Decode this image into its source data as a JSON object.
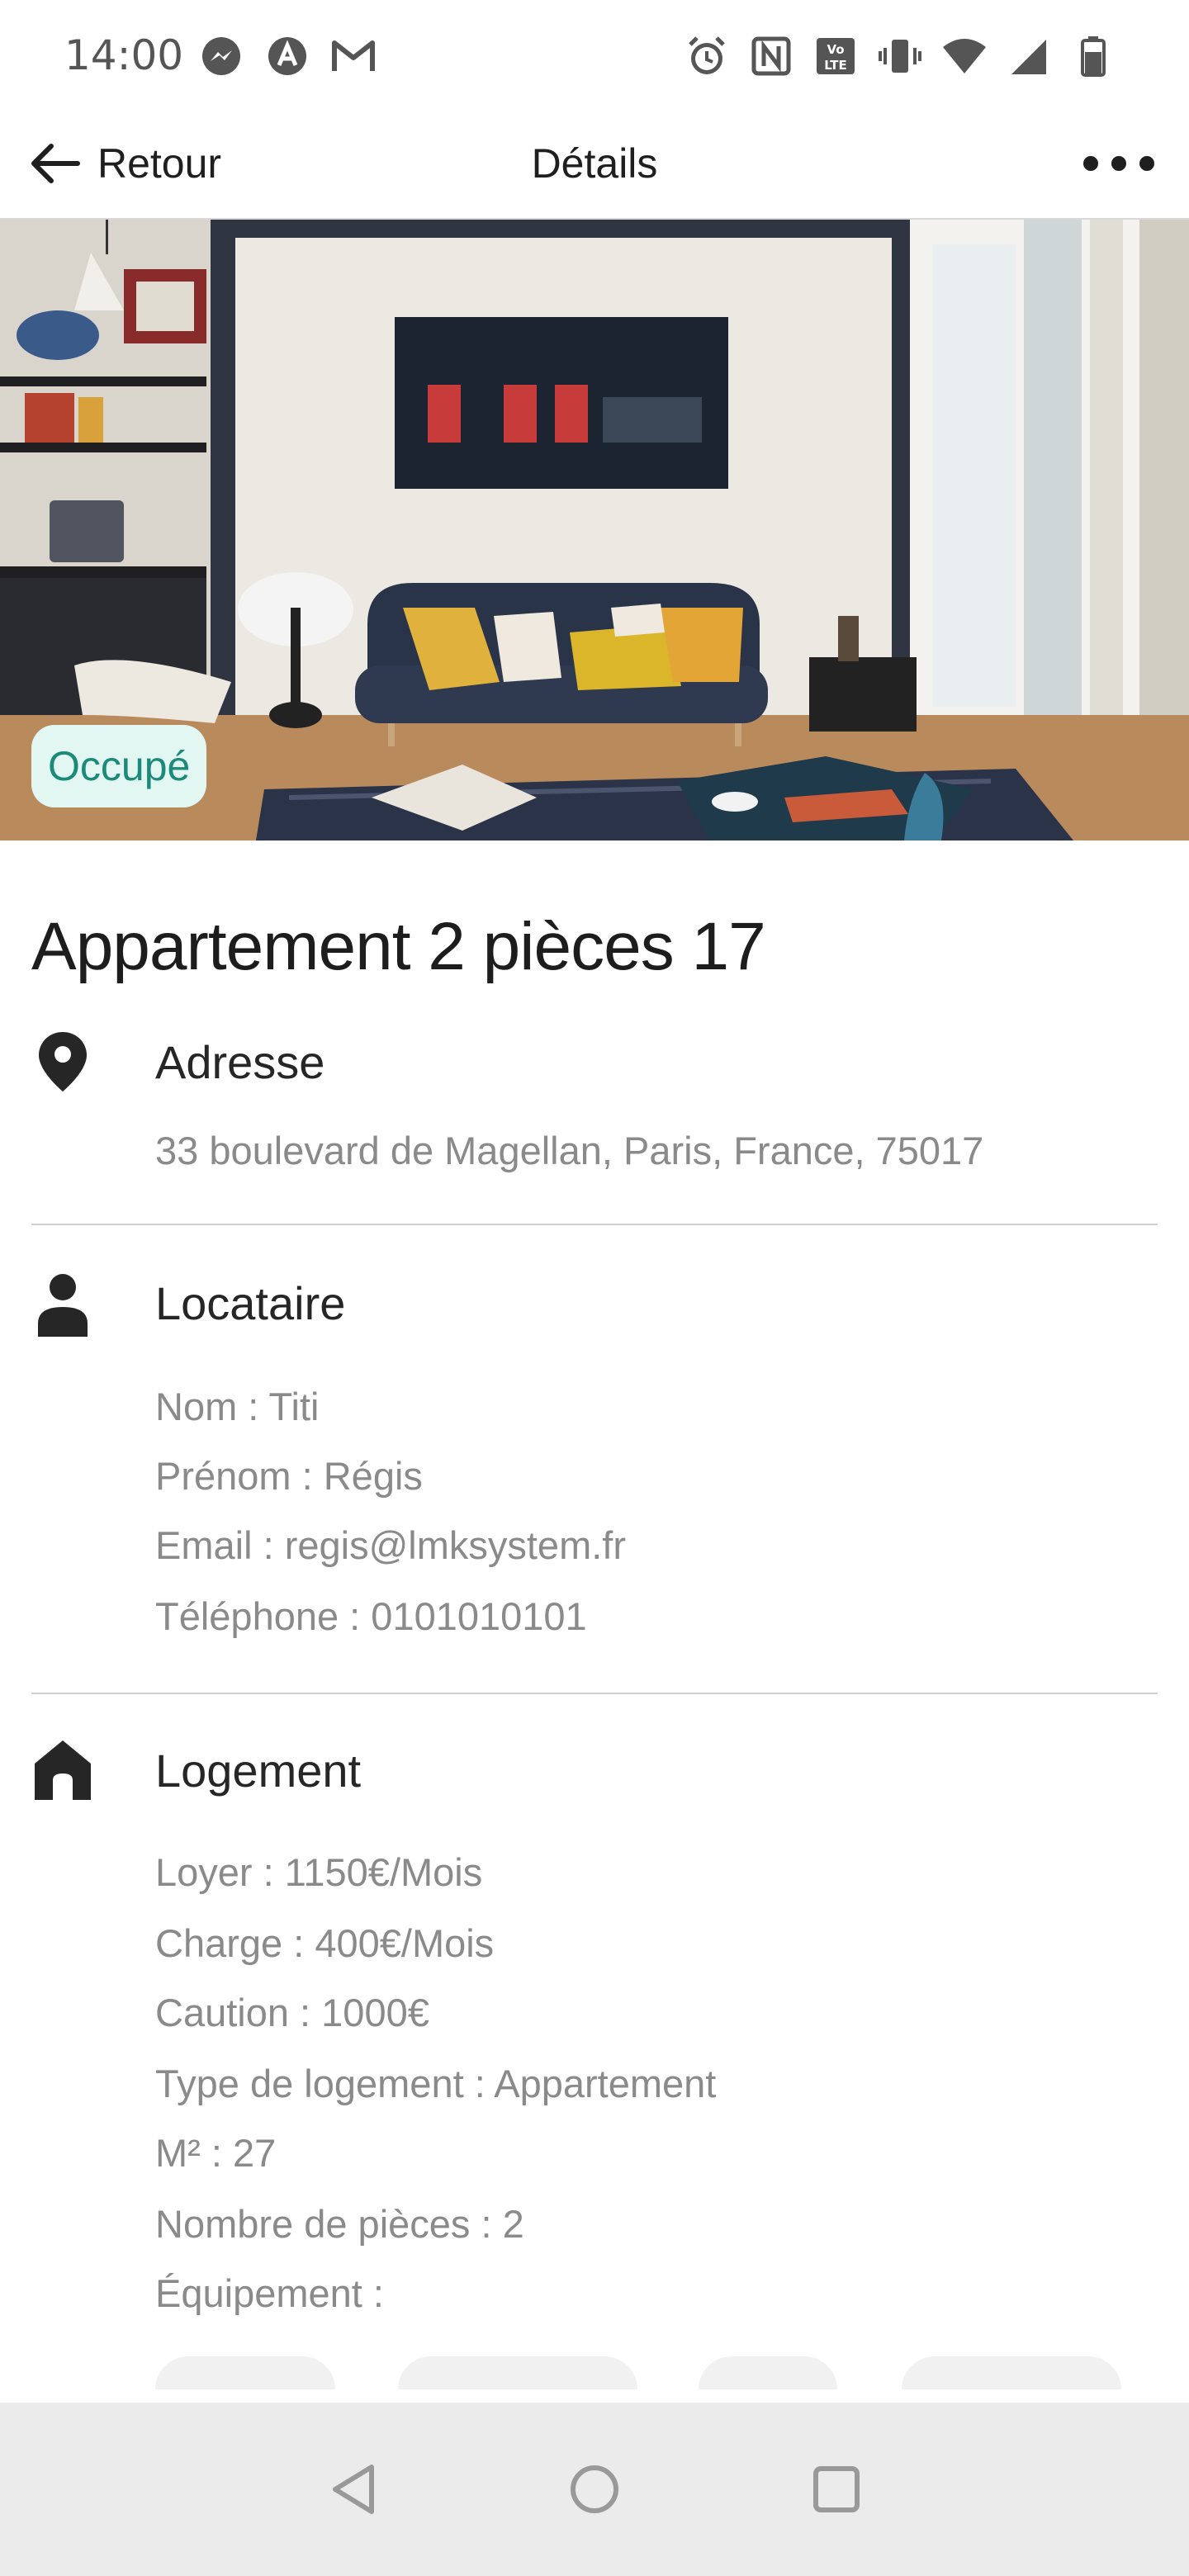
{
  "status_bar": {
    "time": "14:00",
    "left_icons": [
      "messenger-icon",
      "app-icon",
      "gmail-icon"
    ],
    "right_icons": [
      "alarm-icon",
      "nfc-icon",
      "volte-icon",
      "vibrate-icon",
      "wifi-icon",
      "signal-icon",
      "battery-icon"
    ]
  },
  "appbar": {
    "back_label": "Retour",
    "title": "Détails",
    "more_icon": "more-horizontal-icon"
  },
  "hero": {
    "badge": "Occupé",
    "badge_color": "#1b8a78",
    "badge_bg": "#e2f7f2"
  },
  "property": {
    "title": "Appartement 2 pièces 17"
  },
  "address": {
    "heading": "Adresse",
    "icon": "location-pin-icon",
    "value": "33 boulevard de Magellan, Paris, France, 75017"
  },
  "tenant": {
    "heading": "Locataire",
    "icon": "person-icon",
    "lines": [
      "Nom : Titi",
      "Prénom : Régis",
      "Email : regis@lmksystem.fr",
      "Téléphone : 0101010101"
    ]
  },
  "housing": {
    "heading": "Logement",
    "icon": "home-icon",
    "lines": [
      "Loyer : 1150€/Mois",
      "Charge : 400€/Mois",
      "Caution : 1000€",
      "Type de logement : Appartement",
      "M² : 27",
      "Nombre de pièces : 2",
      "Équipement :"
    ]
  },
  "navbar": {
    "icons": [
      "nav-back-icon",
      "nav-home-icon",
      "nav-recents-icon"
    ]
  }
}
